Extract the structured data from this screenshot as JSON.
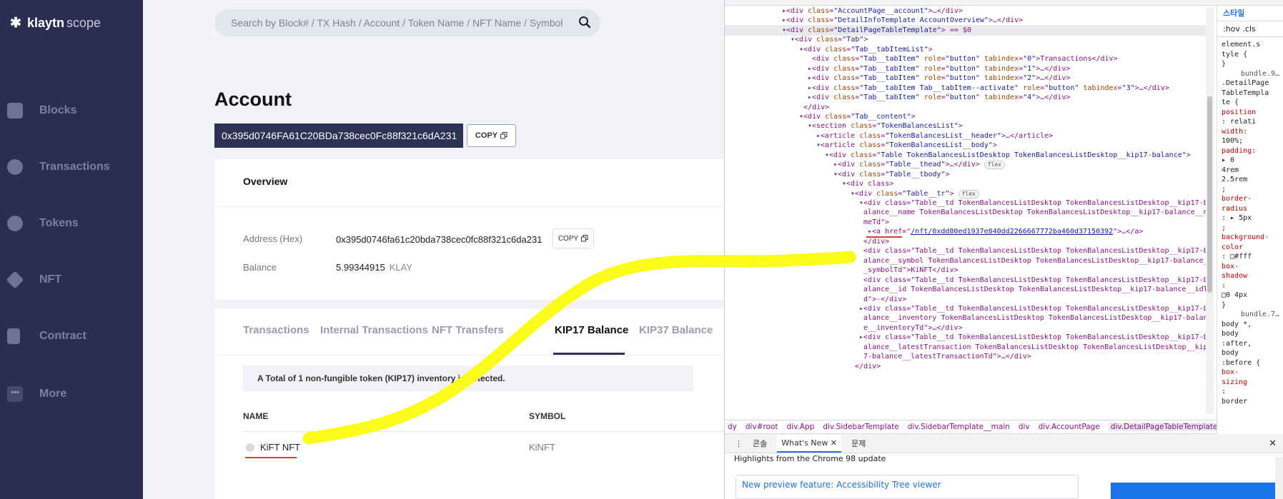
{
  "sidebar": {
    "logo_main": "klaytn",
    "logo_sub": "scope",
    "items": [
      {
        "label": "Blocks",
        "icon": "cube-icon"
      },
      {
        "label": "Transactions",
        "icon": "transactions-icon"
      },
      {
        "label": "Tokens",
        "icon": "tokens-icon"
      },
      {
        "label": "NFT",
        "icon": "diamond-icon"
      },
      {
        "label": "Contract",
        "icon": "contract-icon"
      },
      {
        "label": "More",
        "icon": "more-dots-icon"
      }
    ]
  },
  "search": {
    "placeholder": "Search by Block# / TX Hash / Account / Token Name / NFT Name / Symbol"
  },
  "page": {
    "title": "Account",
    "address": "0x395d0746FA61C20BDa738cec0Fc88f321c6dA231",
    "copy_label": "COPY"
  },
  "overview": {
    "title": "Overview",
    "address_label": "Address (Hex)",
    "address_value": "0x395d0746fa61c20bda738cec0fc88f321c6da231",
    "copy_label": "COPY",
    "balance_label": "Balance",
    "balance_value": "5.99344915",
    "balance_unit": "KLAY"
  },
  "tabs": {
    "items": [
      "Transactions",
      "Internal Transactions",
      "NFT Transfers",
      "KIP17 Balance",
      "KIP37 Balance"
    ],
    "active_index": 3,
    "notice": "A Total of 1 non-fungible token (KIP17) inventory is detected.",
    "columns": [
      "NAME",
      "SYMBOL"
    ],
    "rows": [
      {
        "name": "KiFT NFT",
        "symbol": "KiNFT"
      }
    ]
  },
  "devtools": {
    "lines": [
      {
        "indent": 0,
        "tri": "▸",
        "html": "<div class=\"AccountPage__account\">…</div>"
      },
      {
        "indent": 0,
        "tri": "▸",
        "html": "<div class=\"DetailInfoTemplate AccountOverview\">…</div>"
      },
      {
        "indent": 0,
        "tri": "▾",
        "html": "<div class=\"DetailPageTableTemplate\"> == $0",
        "selected": true
      },
      {
        "indent": 1,
        "tri": "▾",
        "html": "<div class=\"Tab\">"
      },
      {
        "indent": 2,
        "tri": "▾",
        "html": "<div class=\"Tab__tabItemList\">"
      },
      {
        "indent": 3,
        "tri": " ",
        "html": "<div class=\"Tab__tabItem\" role=\"button\" tabindex=\"0\">Transactions</div>"
      },
      {
        "indent": 3,
        "tri": "▸",
        "html": "<div class=\"Tab__tabItem\" role=\"button\" tabindex=\"1\">…</div>"
      },
      {
        "indent": 3,
        "tri": "▸",
        "html": "<div class=\"Tab__tabItem\" role=\"button\" tabindex=\"2\">…</div>"
      },
      {
        "indent": 3,
        "tri": "▸",
        "html": "<div class=\"Tab__tabItem Tab__tabItem--activate\" role=\"button\" tabindex=\"3\">…</div>"
      },
      {
        "indent": 3,
        "tri": "▸",
        "html": "<div class=\"Tab__tabItem\" role=\"button\" tabindex=\"4\">…</div>"
      },
      {
        "indent": 2,
        "tri": " ",
        "html": "</div>"
      },
      {
        "indent": 2,
        "tri": "▾",
        "html": "<div class=\"Tab__content\">"
      },
      {
        "indent": 3,
        "tri": "▾",
        "html": "<section class=\"TokenBalancesList\">"
      },
      {
        "indent": 4,
        "tri": "▸",
        "html": "<article class=\"TokenBalancesList__header\">…</article>"
      },
      {
        "indent": 4,
        "tri": "▾",
        "html": "<article class=\"TokenBalancesList__body\">"
      },
      {
        "indent": 5,
        "tri": "▾",
        "html": "<div class=\"Table TokenBalancesListDesktop TokenBalancesListDesktop__kip17-balance\">"
      },
      {
        "indent": 6,
        "tri": "▸",
        "html": "<div class=\"Table__thead\">…</div>",
        "pill": "flex"
      },
      {
        "indent": 6,
        "tri": "▾",
        "html": "<div class=\"Table__tbody\">"
      },
      {
        "indent": 7,
        "tri": "▾",
        "html": "<div class>"
      },
      {
        "indent": 8,
        "tri": "▾",
        "html": "<div class=\"Table__tr\">",
        "pill": "flex"
      },
      {
        "indent": 9,
        "tri": "▾",
        "html": "<div class=\"Table__td TokenBalancesListDesktop TokenBalancesListDesktop__kip17-b"
      },
      {
        "indent": 9,
        "tri": " ",
        "html": "alance__name TokenBalancesListDesktop TokenBalancesListDesktop__kip17-balance__na"
      },
      {
        "indent": 9,
        "tri": " ",
        "html": "meTd\">"
      },
      {
        "indent": 10,
        "tri": "▸",
        "html": "<a href=\"",
        "link": "/nft/0xdd80ed1937e840dd2266667772ba460d37150392",
        "after": "\">…</a>"
      },
      {
        "indent": 9,
        "tri": " ",
        "html": "</div>"
      },
      {
        "indent": 9,
        "tri": " ",
        "html": "<div class=\"Table__td TokenBalancesListDesktop TokenBalancesListDesktop__kip17-b"
      },
      {
        "indent": 9,
        "tri": " ",
        "html": "alance__symbol TokenBalancesListDesktop TokenBalancesListDesktop__kip17-balance_"
      },
      {
        "indent": 9,
        "tri": " ",
        "html": "_symbolTd\">KiNFT</div>"
      },
      {
        "indent": 9,
        "tri": " ",
        "html": "<div class=\"Table__td TokenBalancesListDesktop TokenBalancesListDesktop__kip17-b"
      },
      {
        "indent": 9,
        "tri": " ",
        "html": "alance__id TokenBalancesListDesktop TokenBalancesListDesktop__kip17-balance__idT"
      },
      {
        "indent": 9,
        "tri": " ",
        "html": "d\">-</div>"
      },
      {
        "indent": 9,
        "tri": "▸",
        "html": "<div class=\"Table__td TokenBalancesListDesktop TokenBalancesListDesktop__kip17-b"
      },
      {
        "indent": 9,
        "tri": " ",
        "html": "alance__inventory TokenBalancesListDesktop TokenBalancesListDesktop__kip17-balanc"
      },
      {
        "indent": 9,
        "tri": " ",
        "html": "e__inventoryTd\">…</div>"
      },
      {
        "indent": 9,
        "tri": "▸",
        "html": "<div class=\"Table__td TokenBalancesListDesktop TokenBalancesListDesktop__kip17-b"
      },
      {
        "indent": 9,
        "tri": " ",
        "html": "alance__latestTransaction TokenBalancesListDesktop TokenBalancesListDesktop__kip1"
      },
      {
        "indent": 9,
        "tri": " ",
        "html": "7-balance__latestTransactionTd\">…</div>"
      },
      {
        "indent": 8,
        "tri": " ",
        "html": "</div>"
      }
    ],
    "breadcrumbs": [
      "dy",
      "div#root",
      "div.App",
      "div.SidebarTemplate",
      "div.SidebarTemplate__main",
      "div",
      "div.AccountPage",
      "div.DetailPageTableTemplate"
    ],
    "styles_tabs": [
      "스타일",
      ":hov  .cls"
    ],
    "styles_lines": [
      "element.s",
      "tyle {",
      "}",
      "bundle.9…",
      ".DetailPage",
      "TableTempla",
      "te {",
      "position",
      ": relati",
      "width:",
      "100%;",
      "padding:",
      "▸ 0",
      "4rem",
      "2.5rem",
      ";",
      "border-",
      "radius",
      ": ▸ 5px",
      ";",
      "background-",
      "color",
      ": □#fff",
      "box-",
      "shadow",
      ":",
      "□0 4px",
      "}",
      "bundle.7…",
      "body *,",
      "body",
      ":after,",
      "body",
      ":before {",
      "box-",
      "sizing",
      ":",
      "border"
    ],
    "drawer_tabs": [
      "콘솔",
      "What's New",
      "문제"
    ],
    "highlights": "Highlights from the Chrome 98 update",
    "news_title": "New preview feature: Accessibility Tree viewer"
  },
  "colors": {
    "sidebar": "#2b2d52",
    "accent": "#2d3254",
    "highlight": "#fcfc1c",
    "underline_red": "#e23b3b"
  }
}
